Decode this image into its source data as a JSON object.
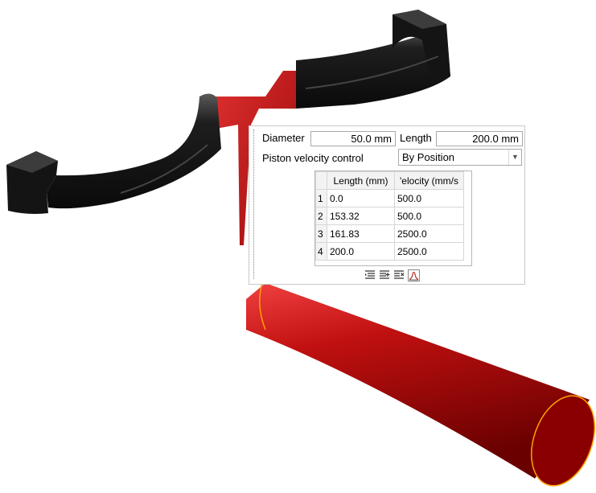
{
  "panel": {
    "diameter_label": "Diameter",
    "diameter_value": "50.0 mm",
    "length_label": "Length",
    "length_value": "200.0 mm",
    "piston_label": "Piston velocity control",
    "piston_value": "By Position"
  },
  "table": {
    "headers": [
      "Length (mm)",
      "'elocity (mm/s"
    ],
    "rows": [
      {
        "n": "1",
        "length": "0.0",
        "velocity": "500.0"
      },
      {
        "n": "2",
        "length": "153.32",
        "velocity": "500.0"
      },
      {
        "n": "3",
        "length": "161.83",
        "velocity": "2500.0"
      },
      {
        "n": "4",
        "length": "200.0",
        "velocity": "2500.0"
      }
    ]
  },
  "toolbar": {
    "icons": [
      "insert-row-icon",
      "add-row-icon",
      "delete-row-icon",
      "chart-icon"
    ]
  },
  "colors": {
    "model_black": "#1a1a1a",
    "model_red": "#c81414",
    "cylinder_edge": "#ffa000"
  }
}
